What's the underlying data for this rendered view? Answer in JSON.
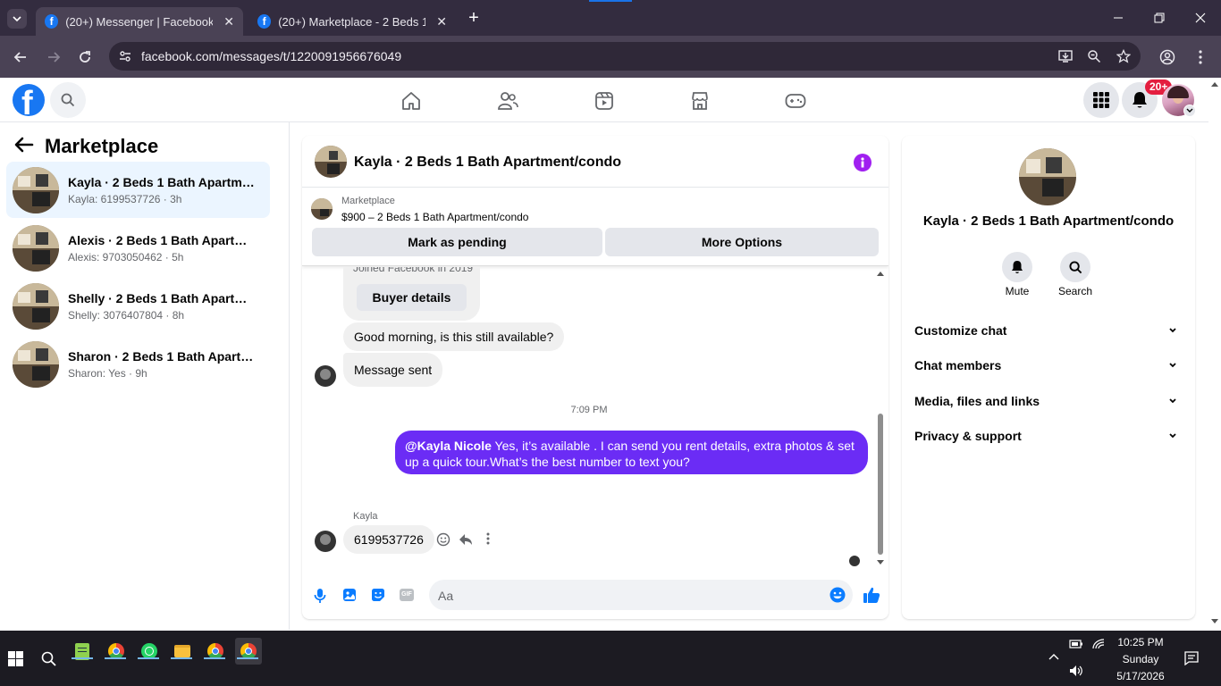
{
  "browser": {
    "tabs": [
      {
        "title": "(20+) Messenger | Facebook",
        "active": true
      },
      {
        "title": "(20+) Marketplace - 2 Beds 1 Ba",
        "active": false
      }
    ],
    "url": "facebook.com/messages/t/1220091956676049"
  },
  "fb": {
    "notification_badge": "20+"
  },
  "left": {
    "title": "Marketplace",
    "conversations": [
      {
        "name": "Kayla · 2 Beds 1 Bath Apartment...",
        "sub": "Kayla: 6199537726 · 3h"
      },
      {
        "name": "Alexis · 2 Beds 1 Bath Apartmen...",
        "sub": "Alexis: 9703050462 · 5h"
      },
      {
        "name": "Shelly · 2 Beds 1 Bath Apartmen...",
        "sub": "Shelly: 3076407804 · 8h"
      },
      {
        "name": "Sharon · 2 Beds 1 Bath Apartme...",
        "sub": "Sharon: Yes · 9h"
      }
    ]
  },
  "chat": {
    "title": "Kayla · 2 Beds 1 Bath Apartment/condo",
    "marketplace_label": "Marketplace",
    "listing": "$900 – 2 Beds 1 Bath Apartment/condo",
    "mark_pending": "Mark as pending",
    "more_options": "More Options",
    "joined_text": "Joined Facebook in 2019",
    "buyer_details": "Buyer details",
    "msg_good_morning": "Good morning, is this still available?",
    "msg_sent": "Message sent",
    "timestamp": "7:09 PM",
    "outgoing_mention": "@Kayla Nicole",
    "outgoing_text": " Yes, it’s available .  I can send you rent details, extra photos & set up a quick tour.What’s the best number to text you?",
    "sender_name": "Kayla",
    "last_msg": "6199537726",
    "composer_placeholder": "Aa"
  },
  "right": {
    "name": "Kayla · 2 Beds 1 Bath Apartment/condo",
    "mute": "Mute",
    "search": "Search",
    "sections": [
      "Customize chat",
      "Chat members",
      "Media, files and links",
      "Privacy & support"
    ]
  },
  "taskbar": {
    "time": "10:25 PM",
    "day": "Sunday",
    "date": "5/17/2026"
  },
  "colors": {
    "accent": "#1877f2",
    "outgoing_bubble": "#6b2cf5",
    "tab_bar": "#332c3f"
  }
}
